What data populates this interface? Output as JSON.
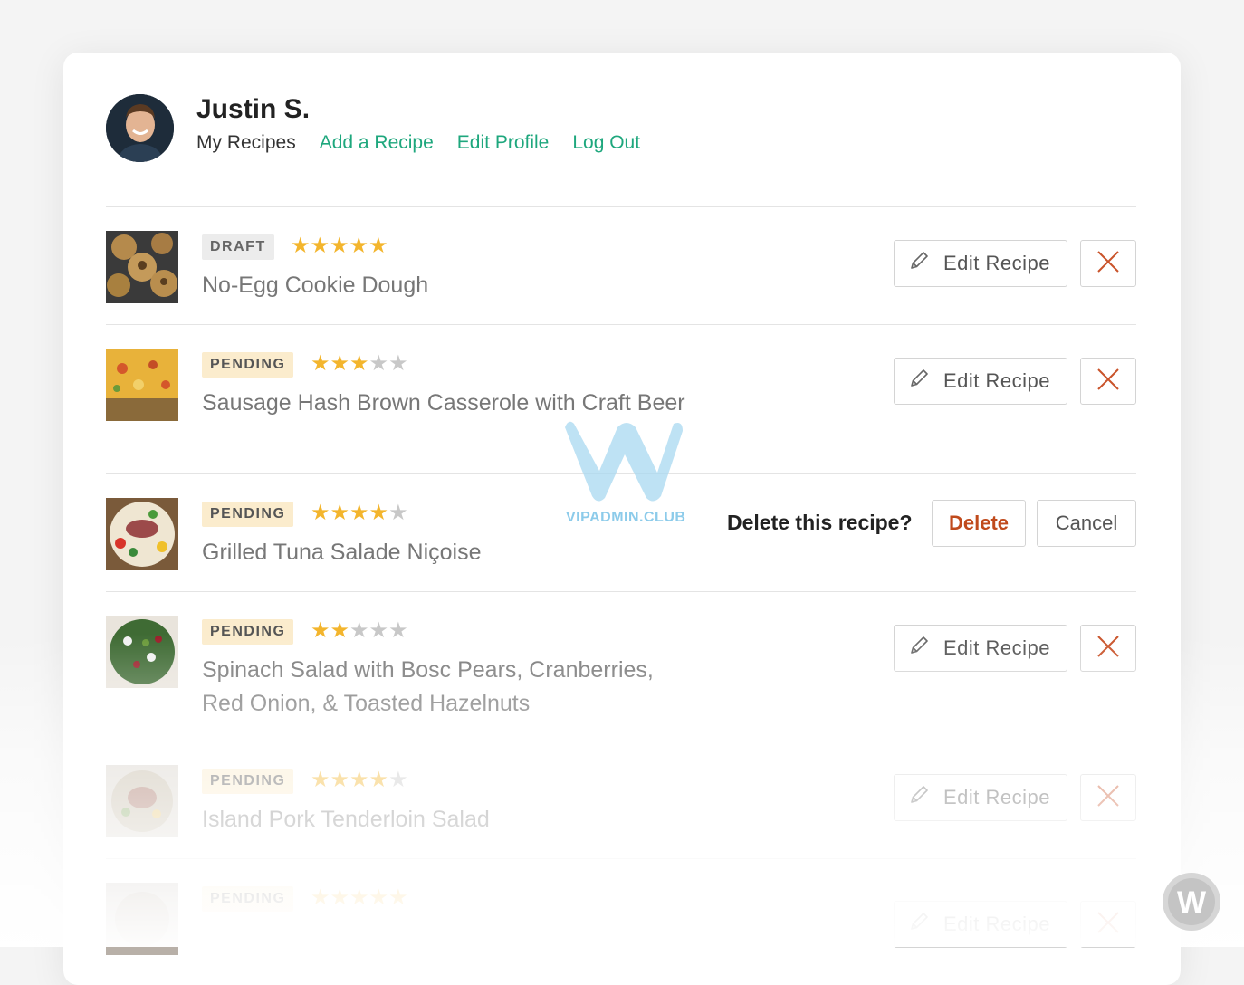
{
  "user": {
    "name": "Justin S."
  },
  "nav": {
    "items": [
      {
        "label": "My Recipes",
        "current": true
      },
      {
        "label": "Add a Recipe"
      },
      {
        "label": "Edit Profile"
      },
      {
        "label": "Log Out"
      }
    ]
  },
  "actions": {
    "edit_label": "Edit Recipe",
    "confirm_prompt": "Delete this recipe?",
    "delete_label": "Delete",
    "cancel_label": "Cancel"
  },
  "recipes": [
    {
      "status": "DRAFT",
      "rating": 5,
      "title": "No-Egg Cookie Dough"
    },
    {
      "status": "PENDING",
      "rating": 3,
      "title": "Sausage Hash Brown Casserole with Craft Beer"
    },
    {
      "status": "PENDING",
      "rating": 4,
      "title": "Grilled Tuna Salade Niçoise",
      "confirming_delete": true
    },
    {
      "status": "PENDING",
      "rating": 2,
      "title": "Spinach Salad with Bosc Pears, Cranberries, Red Onion, & Toasted Hazelnuts"
    },
    {
      "status": "PENDING",
      "rating": 4,
      "title": "Island Pork Tenderloin Salad"
    },
    {
      "status": "PENDING",
      "rating": 5,
      "title": ""
    }
  ],
  "rating_max": 5,
  "watermark": {
    "text": "VIPADMIN.CLUB"
  },
  "colors": {
    "accent": "#1ea77d",
    "star": "#f3b52d",
    "danger": "#c04a1c",
    "draft_bg": "#ececec",
    "pending_bg": "#fbeccd"
  }
}
